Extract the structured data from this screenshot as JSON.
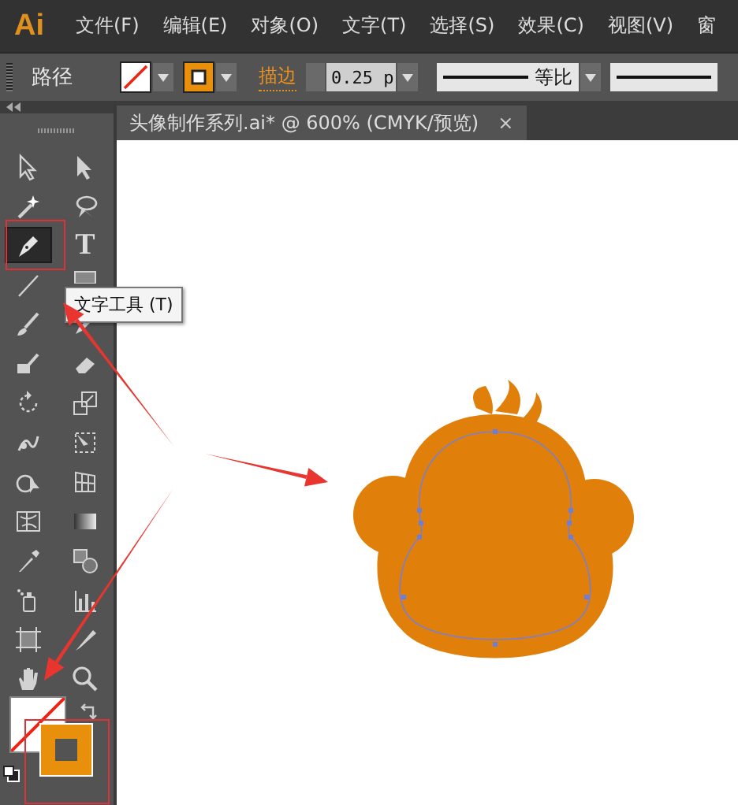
{
  "app": {
    "logo": "Ai"
  },
  "menu": [
    {
      "label": "文件(F)"
    },
    {
      "label": "编辑(E)"
    },
    {
      "label": "对象(O)"
    },
    {
      "label": "文字(T)"
    },
    {
      "label": "选择(S)"
    },
    {
      "label": "效果(C)"
    },
    {
      "label": "视图(V)"
    },
    {
      "label": "窗"
    }
  ],
  "control_bar": {
    "selection_label": "路径",
    "stroke_label": "描边",
    "stroke_weight": "0.25 p",
    "profile_label": "等比"
  },
  "document_tab": {
    "title": "头像制作系列.ai* @ 600% (CMYK/预览)",
    "close": "×"
  },
  "tools": [
    {
      "kind": "selection-arrow",
      "selected": false
    },
    {
      "kind": "direct-arrow",
      "selected": false
    },
    {
      "kind": "magic-wand",
      "selected": false
    },
    {
      "kind": "lasso",
      "selected": false
    },
    {
      "kind": "pen",
      "selected": true
    },
    {
      "kind": "type",
      "selected": false,
      "glyph": "T"
    },
    {
      "kind": "line",
      "selected": false
    },
    {
      "kind": "rectangle",
      "selected": false
    },
    {
      "kind": "brush",
      "selected": false
    },
    {
      "kind": "pencil",
      "selected": false
    },
    {
      "kind": "blob-brush",
      "selected": false
    },
    {
      "kind": "eraser",
      "selected": false
    },
    {
      "kind": "rotate",
      "selected": false
    },
    {
      "kind": "scale",
      "selected": false
    },
    {
      "kind": "warp",
      "selected": false
    },
    {
      "kind": "free-transform",
      "selected": false
    },
    {
      "kind": "shape-builder",
      "selected": false
    },
    {
      "kind": "grid",
      "selected": false
    },
    {
      "kind": "mesh",
      "selected": false
    },
    {
      "kind": "gradient",
      "selected": false
    },
    {
      "kind": "eyedropper",
      "selected": false
    },
    {
      "kind": "blend",
      "selected": false
    },
    {
      "kind": "sprayer",
      "selected": false
    },
    {
      "kind": "bar-chart",
      "selected": false
    },
    {
      "kind": "artboard",
      "selected": false
    },
    {
      "kind": "knife",
      "selected": false
    },
    {
      "kind": "hand",
      "selected": false
    },
    {
      "kind": "magnifier",
      "selected": false
    }
  ],
  "tooltip": {
    "text": "文字工具 (T)"
  }
}
